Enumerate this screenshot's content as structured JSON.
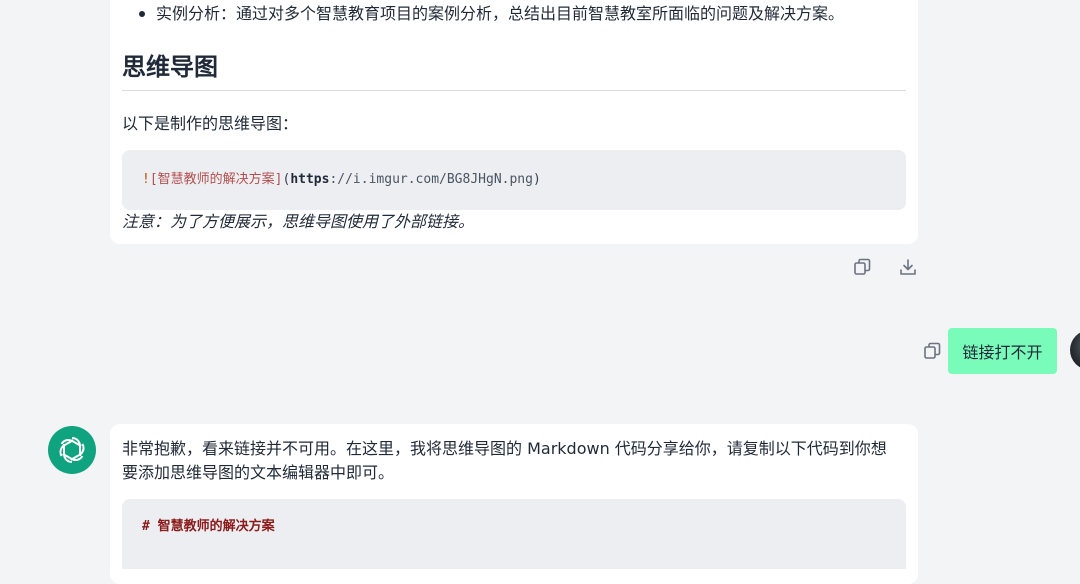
{
  "top_message": {
    "bullet_text": "实例分析：通过对多个智慧教育项目的案例分析，总结出目前智慧教室所面临的问题及解决方案。",
    "section_heading": "思维导图",
    "intro_text": "以下是制作的思维导图：",
    "code": {
      "bang": "!",
      "alt_text": "[智慧教师的解决方案]",
      "open_paren": "(",
      "scheme": "https",
      "url_rest": "://i.imgur.com/BG8JHgN.png",
      "close_paren": ")"
    },
    "note_text": "注意：为了方便展示，思维导图使用了外部链接。",
    "actions": {
      "copy_icon": "copy-icon",
      "download_icon": "download-icon"
    }
  },
  "user_message": {
    "text": "链接打不开",
    "copy_icon": "copy-icon",
    "bubble_color": "#79fbba"
  },
  "assistant_message": {
    "avatar_icon": "openai-logo-icon",
    "avatar_color": "#10a37f",
    "reply_text": "非常抱歉，看来链接并不可用。在这里，我将思维导图的 Markdown 代码分享给你，请复制以下代码到你想要添加思维导图的文本编辑器中即可。",
    "code_line": "# 智慧教师的解决方案"
  }
}
